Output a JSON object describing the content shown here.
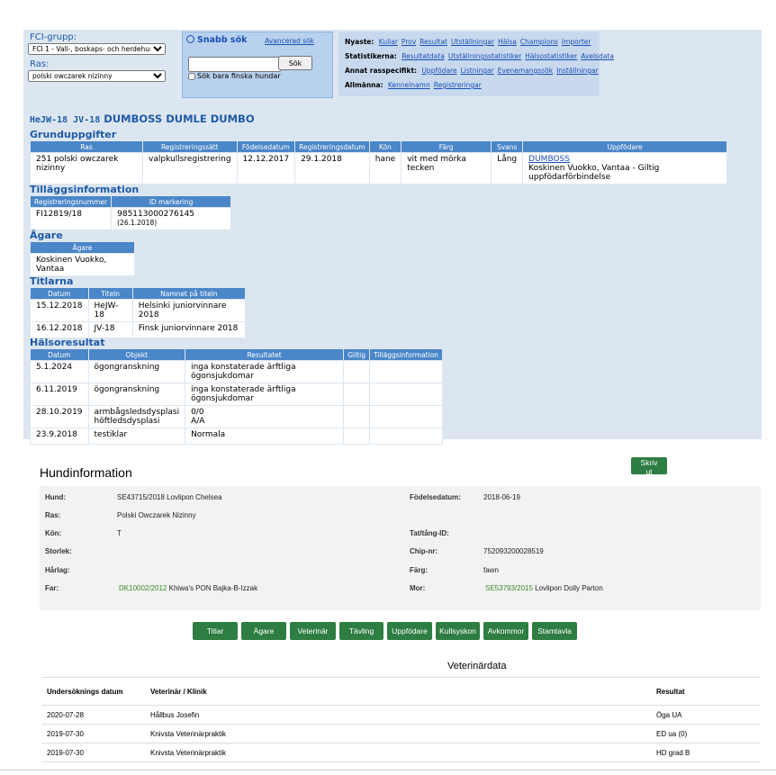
{
  "search": {
    "fci_label": "FCI-grupp:",
    "fci_value": "FCI 1 - Vall-, boskaps- och herdehundar",
    "ras_label": "Ras:",
    "ras_value": "polski owczarek nizinny",
    "quick_title": "Snabb sök",
    "advanced_link": "Avancerad sök",
    "search_button": "Sök",
    "finnish_only": "Sök bara finska hundar"
  },
  "links": {
    "nyaste": {
      "label": "Nyaste:",
      "items": [
        "Kullar",
        "Prov",
        "Resultat",
        "Utställningar",
        "Hälsa",
        "Champions",
        "Importer"
      ]
    },
    "statistik": {
      "label": "Statistikerna:",
      "items": [
        "Resultatdata",
        "Utställningsstatistiker",
        "Hälsostatistiker",
        "Avelsdata"
      ]
    },
    "annat": {
      "label": "Annat rasspecifikt:",
      "items": [
        "Uppfödare",
        "Listningar",
        "Evenemangssök",
        "Inställningar"
      ]
    },
    "allmanna": {
      "label": "Allmänna:",
      "items": [
        "Kennelnamn",
        "Registreringar"
      ]
    }
  },
  "dog": {
    "title_prefix": "HeJW-18 JV-18",
    "name": "DUMBOSS DUMLE DUMBO"
  },
  "grund": {
    "title": "Grunduppgifter",
    "headers": [
      "Ras",
      "Registreringssätt",
      "Födelsedatum",
      "Registreringsdatum",
      "Kön",
      "Färg",
      "Svans",
      "Uppfödare"
    ],
    "row": [
      "251 polski owczarek nizinny",
      "valpkullsregistrering",
      "12.12.2017",
      "29.1.2018",
      "hane",
      "vit med mörka tecken",
      "Lång"
    ],
    "breeder_link": "DUMBOSS",
    "breeder_text": "Koskinen Vuokko, Vantaa - Giltig uppfödarförbindelse"
  },
  "tillagg": {
    "title": "Tilläggsinformation",
    "headers": [
      "Registreringsnummer",
      "ID markering"
    ],
    "reg": "FI12819/18",
    "id": "985113000276145",
    "id_date": "(26.1.2018)"
  },
  "agare": {
    "title": "Ägare",
    "header": "Ägare",
    "value": "Koskinen Vuokko, Vantaa"
  },
  "titlar": {
    "title": "Titlarna",
    "headers": [
      "Datum",
      "Titeln",
      "Namnet på titeln"
    ],
    "rows": [
      [
        "15.12.2018",
        "HeJW-18",
        "Helsinki juniorvinnare 2018"
      ],
      [
        "16.12.2018",
        "JV-18",
        "Finsk juniorvinnare 2018"
      ]
    ]
  },
  "halsa": {
    "title": "Hälsoresultat",
    "headers": [
      "Datum",
      "Objekt",
      "Resultatet",
      "Giltig",
      "Tilläggsinformation"
    ],
    "rows": [
      {
        "date": "5.1.2024",
        "obj": "ögongranskning",
        "res": "inga konstaterade ärftliga ögonsjukdomar"
      },
      {
        "date": "6.11.2019",
        "obj": "ögongranskning",
        "res": "inga konstaterade ärftliga ögonsjukdomar"
      },
      {
        "date": "28.10.2019",
        "obj": "armbågsledsdysplasi",
        "obj2": "höftledsdysplasi",
        "res": "0/0",
        "res2": "A/A"
      },
      {
        "date": "23.9.2018",
        "obj": "testiklar",
        "res": "Normala"
      }
    ]
  },
  "hund": {
    "title": "Hundinformation",
    "print": "Skriv ut",
    "labels": {
      "hund": "Hund:",
      "ras": "Ras:",
      "kon": "Kön:",
      "storlek": "Storlek:",
      "harlag": "Hårlag:",
      "far": "Far:",
      "fodelse": "Födelsedatum:",
      "tat": "Tat/tång-ID:",
      "chip": "Chip-nr:",
      "farg": "Färg:",
      "mor": "Mor:"
    },
    "values": {
      "hund": "SE43715/2018 Lovlipon Chelsea",
      "ras": "Polski Owczarek Nizinny",
      "kon": "T",
      "far_reg": "DK10002/2012",
      "far_name": "Khiwa's PON Bajka-B-Izzak",
      "fodelse": "2018-06-19",
      "chip": "752093200028519",
      "farg": "fawn",
      "mor_reg": "SE53793/2015",
      "mor_name": "Lovlipon Dolly Parton"
    }
  },
  "tabs": [
    "Titlar",
    "Ägare",
    "Veterinär",
    "Tävling",
    "Uppfödare",
    "Kullsyskon",
    "Avkommor",
    "Stamtavla"
  ],
  "vet": {
    "title": "Veterinärdata",
    "headers": [
      "Undersöknings datum",
      "Veterinär / Klinik",
      "Resultat"
    ],
    "rows": [
      [
        "2020-07-28",
        "Hållbus Josefin",
        "Öga UA"
      ],
      [
        "2019-07-30",
        "Knivsta Veterinärpraktik",
        "ED ua (0)"
      ],
      [
        "2019-07-30",
        "Knivsta Veterinärpraktik",
        "HD grad B"
      ]
    ]
  }
}
